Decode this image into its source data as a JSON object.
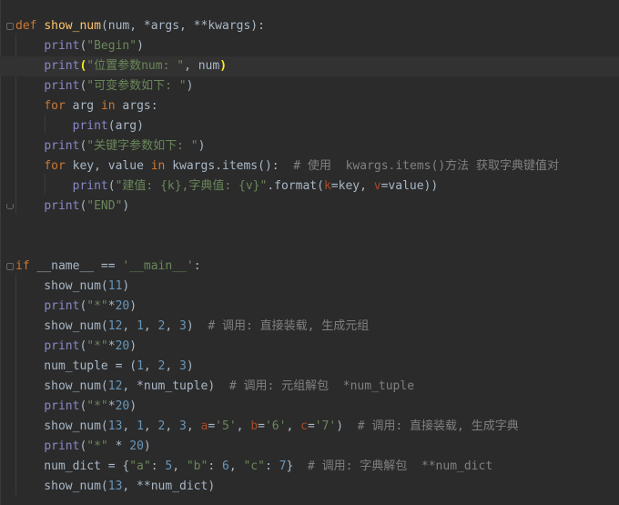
{
  "lines": [
    [
      {
        "t": "def",
        "c": "kw"
      },
      {
        "t": " "
      },
      {
        "t": "show_num",
        "c": "fn"
      },
      {
        "t": "(num, *args, **kwargs):"
      }
    ],
    [
      {
        "t": "    "
      },
      {
        "t": "print",
        "c": "bi"
      },
      {
        "t": "("
      },
      {
        "t": "\"Begin\"",
        "c": "str"
      },
      {
        "t": ")"
      }
    ],
    [
      {
        "t": "    "
      },
      {
        "t": "print",
        "c": "bi"
      },
      {
        "t": "(",
        "c": "br"
      },
      {
        "t": "\"位置参数num: \"",
        "c": "str"
      },
      {
        "t": ", num"
      },
      {
        "t": ")",
        "c": "br"
      }
    ],
    [
      {
        "t": "    "
      },
      {
        "t": "print",
        "c": "bi"
      },
      {
        "t": "("
      },
      {
        "t": "\"可变参数如下: \"",
        "c": "str"
      },
      {
        "t": ")"
      }
    ],
    [
      {
        "t": "    "
      },
      {
        "t": "for",
        "c": "kw"
      },
      {
        "t": " arg "
      },
      {
        "t": "in",
        "c": "kw"
      },
      {
        "t": " args:"
      }
    ],
    [
      {
        "t": "        "
      },
      {
        "t": "print",
        "c": "bi"
      },
      {
        "t": "(arg)"
      }
    ],
    [
      {
        "t": "    "
      },
      {
        "t": "print",
        "c": "bi"
      },
      {
        "t": "("
      },
      {
        "t": "\"关键字参数如下: \"",
        "c": "str"
      },
      {
        "t": ")"
      }
    ],
    [
      {
        "t": "    "
      },
      {
        "t": "for",
        "c": "kw"
      },
      {
        "t": " key, value "
      },
      {
        "t": "in",
        "c": "kw"
      },
      {
        "t": " kwargs.items():  "
      },
      {
        "t": "# 使用  kwargs.items()方法 获取字典键值对",
        "c": "cm"
      }
    ],
    [
      {
        "t": "        "
      },
      {
        "t": "print",
        "c": "bi"
      },
      {
        "t": "("
      },
      {
        "t": "\"建值: {k},字典值: {v}\"",
        "c": "str"
      },
      {
        "t": ".format("
      },
      {
        "t": "k",
        "c": "kwa"
      },
      {
        "t": "=key, "
      },
      {
        "t": "v",
        "c": "kwa"
      },
      {
        "t": "=value))"
      }
    ],
    [
      {
        "t": "    "
      },
      {
        "t": "print",
        "c": "bi"
      },
      {
        "t": "("
      },
      {
        "t": "\"END\"",
        "c": "str"
      },
      {
        "t": ")"
      }
    ],
    [],
    [],
    [
      {
        "t": "if",
        "c": "kw"
      },
      {
        "t": " __name__ == "
      },
      {
        "t": "'__main__'",
        "c": "str"
      },
      {
        "t": ":"
      }
    ],
    [
      {
        "t": "    show_num("
      },
      {
        "t": "11",
        "c": "num"
      },
      {
        "t": ")"
      }
    ],
    [
      {
        "t": "    "
      },
      {
        "t": "print",
        "c": "bi"
      },
      {
        "t": "("
      },
      {
        "t": "\"*\"",
        "c": "str"
      },
      {
        "t": "*"
      },
      {
        "t": "20",
        "c": "num"
      },
      {
        "t": ")"
      }
    ],
    [
      {
        "t": "    show_num("
      },
      {
        "t": "12",
        "c": "num"
      },
      {
        "t": ", "
      },
      {
        "t": "1",
        "c": "num"
      },
      {
        "t": ", "
      },
      {
        "t": "2",
        "c": "num"
      },
      {
        "t": ", "
      },
      {
        "t": "3",
        "c": "num"
      },
      {
        "t": ")  "
      },
      {
        "t": "# 调用: 直接装载, 生成元组",
        "c": "cm"
      }
    ],
    [
      {
        "t": "    "
      },
      {
        "t": "print",
        "c": "bi"
      },
      {
        "t": "("
      },
      {
        "t": "\"*\"",
        "c": "str"
      },
      {
        "t": "*"
      },
      {
        "t": "20",
        "c": "num"
      },
      {
        "t": ")"
      }
    ],
    [
      {
        "t": "    num_tuple = ("
      },
      {
        "t": "1",
        "c": "num"
      },
      {
        "t": ", "
      },
      {
        "t": "2",
        "c": "num"
      },
      {
        "t": ", "
      },
      {
        "t": "3",
        "c": "num"
      },
      {
        "t": ")"
      }
    ],
    [
      {
        "t": "    show_num("
      },
      {
        "t": "12",
        "c": "num"
      },
      {
        "t": ", *num_tuple)  "
      },
      {
        "t": "# 调用: 元组解包  *num_tuple",
        "c": "cm"
      }
    ],
    [
      {
        "t": "    "
      },
      {
        "t": "print",
        "c": "bi"
      },
      {
        "t": "("
      },
      {
        "t": "\"*\"",
        "c": "str"
      },
      {
        "t": "*"
      },
      {
        "t": "20",
        "c": "num"
      },
      {
        "t": ")"
      }
    ],
    [
      {
        "t": "    show_num("
      },
      {
        "t": "13",
        "c": "num"
      },
      {
        "t": ", "
      },
      {
        "t": "1",
        "c": "num"
      },
      {
        "t": ", "
      },
      {
        "t": "2",
        "c": "num"
      },
      {
        "t": ", "
      },
      {
        "t": "3",
        "c": "num"
      },
      {
        "t": ", "
      },
      {
        "t": "a",
        "c": "kwa"
      },
      {
        "t": "="
      },
      {
        "t": "'5'",
        "c": "str"
      },
      {
        "t": ", "
      },
      {
        "t": "b",
        "c": "kwa"
      },
      {
        "t": "="
      },
      {
        "t": "'6'",
        "c": "str"
      },
      {
        "t": ", "
      },
      {
        "t": "c",
        "c": "kwa"
      },
      {
        "t": "="
      },
      {
        "t": "'7'",
        "c": "str"
      },
      {
        "t": ")  "
      },
      {
        "t": "# 调用: 直接装载, 生成字典",
        "c": "cm"
      }
    ],
    [
      {
        "t": "    "
      },
      {
        "t": "print",
        "c": "bi"
      },
      {
        "t": "("
      },
      {
        "t": "\"*\"",
        "c": "str"
      },
      {
        "t": " * "
      },
      {
        "t": "20",
        "c": "num"
      },
      {
        "t": ")"
      }
    ],
    [
      {
        "t": "    num_dict = {"
      },
      {
        "t": "\"a\"",
        "c": "str"
      },
      {
        "t": ": "
      },
      {
        "t": "5",
        "c": "num"
      },
      {
        "t": ", "
      },
      {
        "t": "\"b\"",
        "c": "str"
      },
      {
        "t": ": "
      },
      {
        "t": "6",
        "c": "num"
      },
      {
        "t": ", "
      },
      {
        "t": "\"c\"",
        "c": "str"
      },
      {
        "t": ": "
      },
      {
        "t": "7",
        "c": "num"
      },
      {
        "t": "}  "
      },
      {
        "t": "# 调用: 字典解包  **num_dict",
        "c": "cm"
      }
    ],
    [
      {
        "t": "    show_num("
      },
      {
        "t": "13",
        "c": "num"
      },
      {
        "t": ", **num_dict)"
      }
    ]
  ],
  "current_line": 3,
  "fold_markers": {
    "start": [
      1,
      13
    ],
    "end": [
      10
    ]
  },
  "colors": {
    "background": "#2b2b2b",
    "current_line": "#323232",
    "keyword": "#cc7832",
    "function": "#ffc66d",
    "string": "#6a8759",
    "number": "#6897bb",
    "builtin": "#8888c6",
    "comment": "#808080",
    "kwarg": "#aa4926",
    "text": "#a9b7c6"
  }
}
